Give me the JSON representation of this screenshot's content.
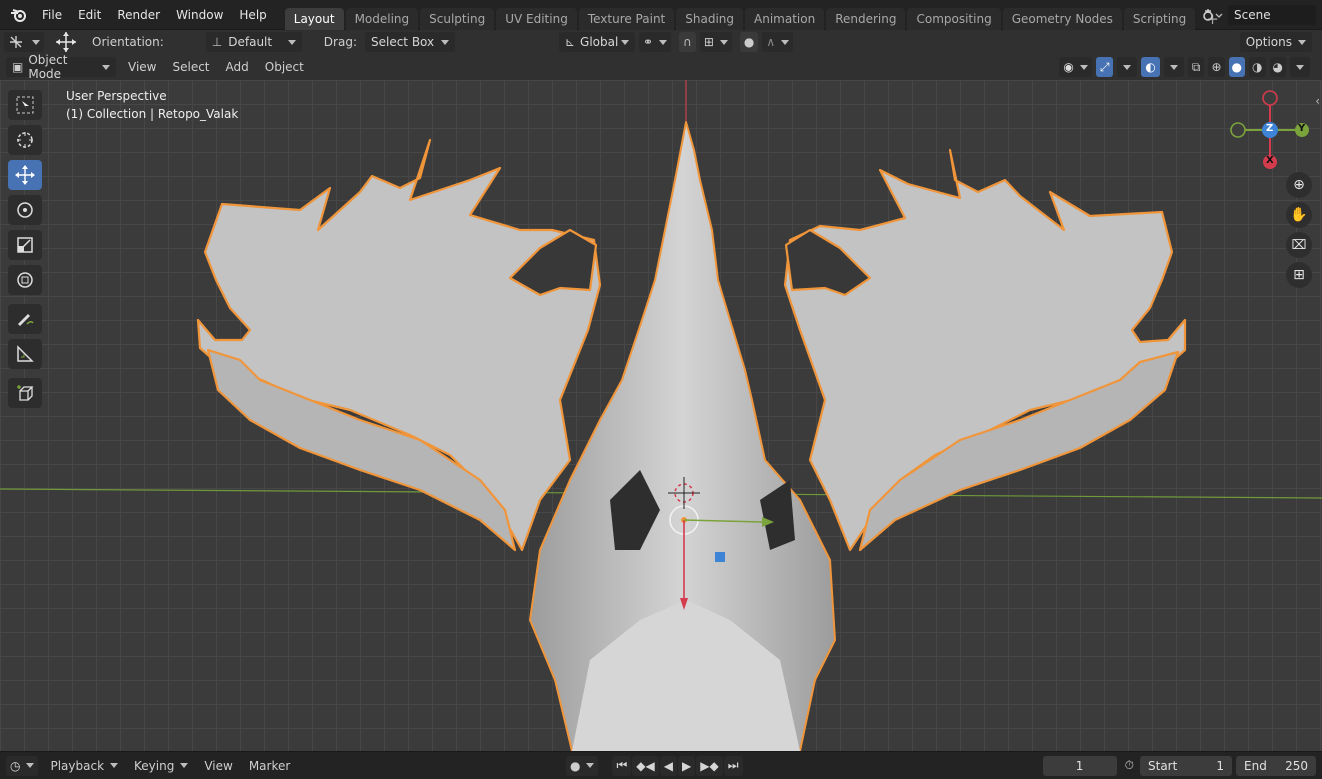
{
  "topbar": {
    "menus": [
      "File",
      "Edit",
      "Render",
      "Window",
      "Help"
    ],
    "workspace_tabs": [
      "Layout",
      "Modeling",
      "Sculpting",
      "UV Editing",
      "Texture Paint",
      "Shading",
      "Animation",
      "Rendering",
      "Compositing",
      "Geometry Nodes",
      "Scripting"
    ],
    "active_tab": "Layout",
    "add_tab": "+",
    "scene": "Scene"
  },
  "tool_header": {
    "orientation_label": "Orientation:",
    "orientation_value": "Default",
    "drag_label": "Drag:",
    "drag_value": "Select Box",
    "transform_orientation": "Global",
    "options": "Options"
  },
  "view_header": {
    "mode": "Object Mode",
    "menus": [
      "View",
      "Select",
      "Add",
      "Object"
    ]
  },
  "viewport": {
    "perspective": "User Perspective",
    "collection_info": "(1) Collection | Retopo_Valak",
    "gizmo_axes": {
      "x": "X",
      "y": "Y",
      "z": "Z"
    },
    "axis_colors": {
      "x": "#d43c4e",
      "y": "#7ba33b",
      "z": "#3d84d6",
      "select": "#f0953a"
    }
  },
  "toolbar": {
    "tools": [
      "select-box",
      "cursor",
      "move",
      "rotate",
      "scale",
      "transform",
      "annotate",
      "measure",
      "add-cube"
    ],
    "active": "move"
  },
  "timeline": {
    "menus": [
      "Playback",
      "Keying",
      "View",
      "Marker"
    ],
    "current_frame": "1",
    "start_label": "Start",
    "start_value": "1",
    "end_label": "End",
    "end_value": "250"
  }
}
